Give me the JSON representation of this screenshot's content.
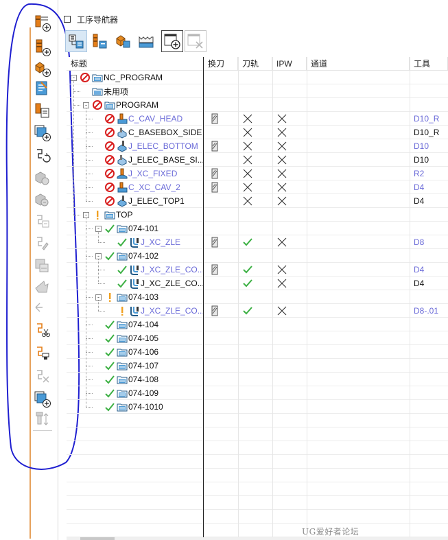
{
  "panel": {
    "title": "工序导航器"
  },
  "columns": [
    {
      "key": "title",
      "label": "标题"
    },
    {
      "key": "tool_change",
      "label": "换刀"
    },
    {
      "key": "toolpath",
      "label": "刀轨"
    },
    {
      "key": "ipw",
      "label": "IPW"
    },
    {
      "key": "channel",
      "label": "通道"
    },
    {
      "key": "tool",
      "label": "工具"
    }
  ],
  "rows": [
    {
      "name": "NC_PROGRAM",
      "level": 0,
      "expander": "-",
      "status": "none",
      "icon": "program-folder-icon",
      "tool_change": false,
      "toolpath": "",
      "ipw": "",
      "tool": ""
    },
    {
      "name": "未用项",
      "level": 1,
      "expander": "",
      "status": "",
      "icon": "unused-folder-icon",
      "tool_change": false,
      "toolpath": "",
      "ipw": "",
      "tool": ""
    },
    {
      "name": "PROGRAM",
      "level": 1,
      "expander": "-",
      "status": "none",
      "icon": "program-folder-icon",
      "tool_change": false,
      "toolpath": "",
      "ipw": "",
      "tool": ""
    },
    {
      "name": "C_CAV_HEAD",
      "level": 2,
      "expander": "",
      "status": "none",
      "icon": "cavity-mill-icon",
      "blue": true,
      "tool_change": true,
      "toolpath": "x",
      "ipw": "x",
      "tool": "D10_R",
      "tool_blue": true
    },
    {
      "name": "C_BASEBOX_SIDE",
      "level": 2,
      "expander": "",
      "status": "none",
      "icon": "zlevel-mill-icon",
      "blue": false,
      "tool_change": false,
      "toolpath": "x",
      "ipw": "x",
      "tool": "D10_R",
      "tool_blue": false
    },
    {
      "name": "J_ELEC_BOTTOM",
      "level": 2,
      "expander": "",
      "status": "none",
      "icon": "floor-mill-icon",
      "blue": true,
      "tool_change": true,
      "toolpath": "x",
      "ipw": "x",
      "tool": "D10",
      "tool_blue": true
    },
    {
      "name": "J_ELEC_BASE_SI...",
      "level": 2,
      "expander": "",
      "status": "none",
      "icon": "zlevel-mill-icon",
      "blue": false,
      "tool_change": false,
      "toolpath": "x",
      "ipw": "x",
      "tool": "D10",
      "tool_blue": false
    },
    {
      "name": "J_XC_FIXED",
      "level": 2,
      "expander": "",
      "status": "none",
      "icon": "fixed-contour-icon",
      "blue": true,
      "tool_change": true,
      "toolpath": "x",
      "ipw": "x",
      "tool": "R2",
      "tool_blue": true
    },
    {
      "name": "C_XC_CAV_2",
      "level": 2,
      "expander": "",
      "status": "none",
      "icon": "cavity-mill-icon",
      "blue": true,
      "tool_change": true,
      "toolpath": "x",
      "ipw": "x",
      "tool": "D4",
      "tool_blue": true
    },
    {
      "name": "J_ELEC_TOP1",
      "level": 2,
      "expander": "",
      "status": "none",
      "icon": "floor-mill-icon",
      "blue": false,
      "tool_change": false,
      "toolpath": "x",
      "ipw": "x",
      "tool": "D4",
      "tool_blue": false
    },
    {
      "name": "TOP",
      "level": 1,
      "expander": "-",
      "status": "warn",
      "icon": "program-folder-icon",
      "tool_change": false,
      "toolpath": "",
      "ipw": "",
      "tool": ""
    },
    {
      "name": "074-101",
      "level": 2,
      "expander": "-",
      "status": "ok",
      "icon": "program-folder-icon",
      "tool_change": false,
      "toolpath": "",
      "ipw": "",
      "tool": ""
    },
    {
      "name": "J_XC_ZLE",
      "level": 3,
      "expander": "",
      "status": "ok",
      "icon": "zlevel-op-icon",
      "blue": true,
      "tool_change": true,
      "toolpath": "ok",
      "ipw": "x",
      "tool": "D8",
      "tool_blue": true
    },
    {
      "name": "074-102",
      "level": 2,
      "expander": "-",
      "status": "ok",
      "icon": "program-folder-icon",
      "tool_change": false,
      "toolpath": "",
      "ipw": "",
      "tool": ""
    },
    {
      "name": "J_XC_ZLE_CO...",
      "level": 3,
      "expander": "",
      "status": "ok",
      "icon": "zlevel-op-icon",
      "blue": true,
      "tool_change": true,
      "toolpath": "ok",
      "ipw": "x",
      "tool": "D4",
      "tool_blue": true
    },
    {
      "name": "J_XC_ZLE_CO...",
      "level": 3,
      "expander": "",
      "status": "ok",
      "icon": "zlevel-op-icon",
      "blue": false,
      "tool_change": false,
      "toolpath": "ok",
      "ipw": "x",
      "tool": "D4",
      "tool_blue": false
    },
    {
      "name": "074-103",
      "level": 2,
      "expander": "-",
      "status": "warn",
      "icon": "program-folder-icon",
      "tool_change": false,
      "toolpath": "",
      "ipw": "",
      "tool": ""
    },
    {
      "name": "J_XC_ZLE_CO...",
      "level": 3,
      "expander": "",
      "status": "warn",
      "icon": "zlevel-op-icon",
      "blue": true,
      "tool_change": true,
      "toolpath": "ok",
      "ipw": "x",
      "tool": "D8-.01",
      "tool_blue": true
    },
    {
      "name": "074-104",
      "level": 2,
      "expander": "",
      "status": "ok",
      "icon": "program-folder-icon",
      "tool_change": false,
      "toolpath": "",
      "ipw": "",
      "tool": ""
    },
    {
      "name": "074-105",
      "level": 2,
      "expander": "",
      "status": "ok",
      "icon": "program-folder-icon",
      "tool_change": false,
      "toolpath": "",
      "ipw": "",
      "tool": ""
    },
    {
      "name": "074-106",
      "level": 2,
      "expander": "",
      "status": "ok",
      "icon": "program-folder-icon",
      "tool_change": false,
      "toolpath": "",
      "ipw": "",
      "tool": ""
    },
    {
      "name": "074-107",
      "level": 2,
      "expander": "",
      "status": "ok",
      "icon": "program-folder-icon",
      "tool_change": false,
      "toolpath": "",
      "ipw": "",
      "tool": ""
    },
    {
      "name": "074-108",
      "level": 2,
      "expander": "",
      "status": "ok",
      "icon": "program-folder-icon",
      "tool_change": false,
      "toolpath": "",
      "ipw": "",
      "tool": ""
    },
    {
      "name": "074-109",
      "level": 2,
      "expander": "",
      "status": "ok",
      "icon": "program-folder-icon",
      "tool_change": false,
      "toolpath": "",
      "ipw": "",
      "tool": ""
    },
    {
      "name": "074-1010",
      "level": 2,
      "expander": "",
      "status": "ok",
      "icon": "program-folder-icon",
      "tool_change": false,
      "toolpath": "",
      "ipw": "",
      "tool": ""
    }
  ],
  "toolbar_icons": [
    "create-program-icon",
    "create-tool-icon",
    "create-geometry-icon",
    "create-method-icon",
    "create-operation-icon",
    "copy-operation-icon",
    "generate-toolpath-icon",
    "verify-toolpath-icon",
    "simulate-machine-icon",
    "postprocess-icon",
    "shop-doc-icon",
    "output-cls-icon",
    "feeds-speeds-icon",
    "split-operation-icon",
    "tool-holder-icon",
    "delete-toolpath-icon",
    "insert-operation-icon",
    "tool-orientation-icon"
  ],
  "nav_toolbar_icons": [
    "program-order-view-icon",
    "machine-tool-view-icon",
    "geometry-view-icon",
    "method-view-icon",
    "create-group-icon",
    "delete-group-icon"
  ],
  "colors": {
    "accent_blue": "#6a6ad8",
    "ok_green": "#3cb043",
    "error_red": "#d81e1e",
    "warn_orange": "#f0a020",
    "annotation_blue": "#1f1fd0"
  },
  "watermark": "UG爱好者论坛 WWW.UGSNX.COM"
}
